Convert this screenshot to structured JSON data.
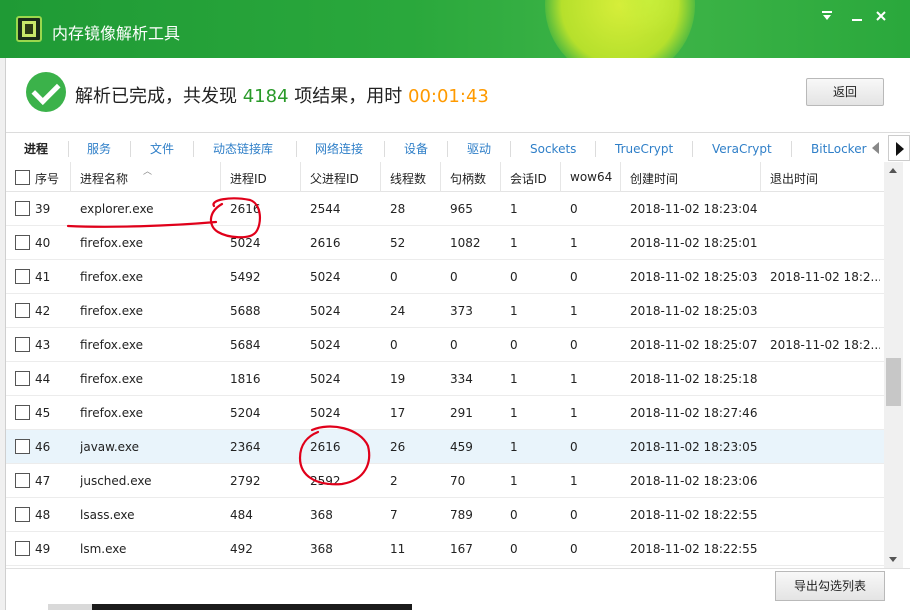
{
  "window": {
    "title": "内存镜像解析工具",
    "minimize_icon": "minimize-icon",
    "close_icon": "close-icon"
  },
  "status": {
    "prefix": "解析已完成，共发现 ",
    "count": "4184",
    "middle": " 项结果，用时 ",
    "time": "00:01:43",
    "back_label": "返回",
    "colors": {
      "count": "#2a9a2a",
      "time": "#ff9a00",
      "check": "#3bb24a"
    }
  },
  "tabs": [
    "进程",
    "服务",
    "文件",
    "动态链接库",
    "网络连接",
    "设备",
    "驱动",
    "Sockets",
    "TrueCrypt",
    "VeraCrypt",
    "BitLocker"
  ],
  "table": {
    "columns": [
      "序号",
      "进程名称",
      "进程ID",
      "父进程ID",
      "线程数",
      "句柄数",
      "会话ID",
      "wow64",
      "创建时间",
      "退出时间"
    ],
    "rows": [
      [
        "39",
        "explorer.exe",
        "2616",
        "2544",
        "28",
        "965",
        "1",
        "0",
        "2018-11-02 18:23:04",
        ""
      ],
      [
        "40",
        "firefox.exe",
        "5024",
        "2616",
        "52",
        "1082",
        "1",
        "1",
        "2018-11-02 18:25:01",
        ""
      ],
      [
        "41",
        "firefox.exe",
        "5492",
        "5024",
        "0",
        "0",
        "0",
        "0",
        "2018-11-02 18:25:03",
        "2018-11-02 18:2..."
      ],
      [
        "42",
        "firefox.exe",
        "5688",
        "5024",
        "24",
        "373",
        "1",
        "1",
        "2018-11-02 18:25:03",
        ""
      ],
      [
        "43",
        "firefox.exe",
        "5684",
        "5024",
        "0",
        "0",
        "0",
        "0",
        "2018-11-02 18:25:07",
        "2018-11-02 18:2..."
      ],
      [
        "44",
        "firefox.exe",
        "1816",
        "5024",
        "19",
        "334",
        "1",
        "1",
        "2018-11-02 18:25:18",
        ""
      ],
      [
        "45",
        "firefox.exe",
        "5204",
        "5024",
        "17",
        "291",
        "1",
        "1",
        "2018-11-02 18:27:46",
        ""
      ],
      [
        "46",
        "javaw.exe",
        "2364",
        "2616",
        "26",
        "459",
        "1",
        "0",
        "2018-11-02 18:23:05",
        ""
      ],
      [
        "47",
        "jusched.exe",
        "2792",
        "2592",
        "2",
        "70",
        "1",
        "1",
        "2018-11-02 18:23:06",
        ""
      ],
      [
        "48",
        "lsass.exe",
        "484",
        "368",
        "7",
        "789",
        "0",
        "0",
        "2018-11-02 18:22:55",
        ""
      ],
      [
        "49",
        "lsm.exe",
        "492",
        "368",
        "11",
        "167",
        "0",
        "0",
        "2018-11-02 18:22:55",
        ""
      ]
    ],
    "highlighted_row": 7,
    "highlight_color": "#e9f4fb"
  },
  "footer": {
    "export_label": "导出勾选列表"
  },
  "colors": {
    "titlebar": "#2aa83c",
    "tab_link": "#2f7fc8",
    "annotation": "#e0001a"
  }
}
